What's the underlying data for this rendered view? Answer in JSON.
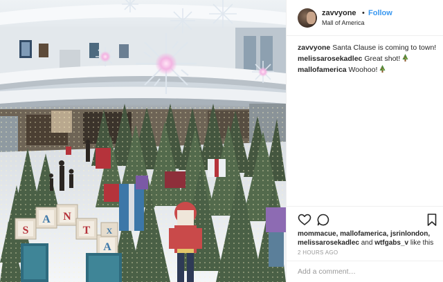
{
  "post": {
    "photo_alt_icon": "mall-christmas-display-photo",
    "author": {
      "username": "zavvyone",
      "dot": "•",
      "follow_label": "Follow",
      "location": "Mall of America"
    },
    "comments": [
      {
        "user": "zavvyone",
        "text": "Santa Clause is coming to town!",
        "emoji": ""
      },
      {
        "user": "melissarosekadlec",
        "text": "Great shot!",
        "emoji": "christmas-tree-icon"
      },
      {
        "user": "mallofamerica",
        "text": "Woohoo!",
        "emoji": "christmas-tree-icon"
      }
    ],
    "likes": {
      "names": "mommacue, mallofamerica, jsrinlondon, melissarosekadlec",
      "and": "and",
      "last": "wtfgabs_v",
      "suffix": "like this"
    },
    "time": "2 HOURS AGO",
    "add_comment_placeholder": "Add a comment…",
    "photo_letters": [
      "S",
      "A",
      "N",
      "T",
      "A",
      "X"
    ],
    "photo_colors": {
      "tree": "#3f5a3a",
      "floor": "#eef1f4",
      "block_red": "#b5333b",
      "block_blue": "#3c77a8"
    },
    "link_color": "#3897f0"
  }
}
